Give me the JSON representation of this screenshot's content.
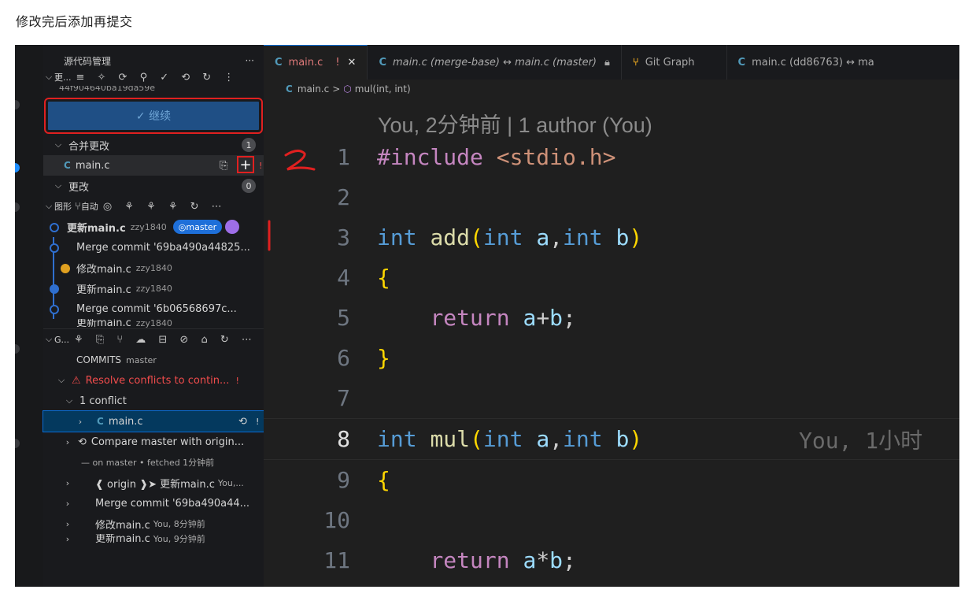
{
  "caption": "修改完后添加再提交",
  "colors": {
    "accent": "#1e6fd9",
    "annotation": "#e02020",
    "conflict": "#f14c4c"
  },
  "sidebar": {
    "title": "源代码管理",
    "more": "···",
    "section_label": "更...",
    "hash_partial": "44f904640ba19da59e",
    "continue_button": "✓ 继续",
    "merge_changes": {
      "label": "合并更改",
      "count": "1"
    },
    "merge_file": {
      "name": "main.c",
      "status": "!"
    },
    "changes": {
      "label": "更改",
      "count": "0"
    },
    "graph_header": {
      "label": "图形",
      "auto": "自动"
    },
    "graph": [
      {
        "message": "更新main.c",
        "author": "zzy1840",
        "branch": "master"
      },
      {
        "message": "Merge commit '69ba490a44825...",
        "author": ""
      },
      {
        "message": "修改main.c",
        "author": "zzy1840"
      },
      {
        "message": "更新main.c",
        "author": "zzy1840"
      },
      {
        "message": "Merge commit '6b06568697c...",
        "author": ""
      },
      {
        "message": "更新main.c",
        "author": "zzy1840"
      }
    ],
    "gitlens": {
      "label": "G...",
      "commits": "COMMITS",
      "branch": "master",
      "resolve": "Resolve conflicts to contin...",
      "resolve_status": "!",
      "conflict_count": "1 conflict",
      "conflict_file": "main.c",
      "conflict_status": "!",
      "compare": "Compare master with origin...",
      "fetched": "— on master • fetched 1分钟前",
      "items": [
        {
          "label": "❰ origin ❱➤  更新main.c",
          "meta": "You,..."
        },
        {
          "label": "Merge commit '69ba490a44...",
          "meta": ""
        },
        {
          "label": "修改main.c",
          "meta": "You, 8分钟前"
        },
        {
          "label": "更新main.c",
          "meta": "You, 9分钟前"
        }
      ]
    }
  },
  "editor": {
    "tabs": [
      {
        "icon": "C",
        "label": "main.c",
        "extra": "!",
        "close": "✕"
      },
      {
        "icon": "C",
        "label": "main.c (merge-base) ↔ main.c (master)",
        "extra": "🔒"
      },
      {
        "icon": "⑂",
        "label": "Git Graph"
      },
      {
        "icon": "C",
        "label": "main.c (dd86763) ↔ ma"
      }
    ],
    "breadcrumb": {
      "file": "main.c",
      "sep": ">",
      "symbol": "mul(int, int)"
    },
    "codelens": "You, 2分钟前 | 1 author (You)",
    "blame_line8": "You, 1小时",
    "lines": [
      "1",
      "2",
      "3",
      "4",
      "5",
      "6",
      "7",
      "8",
      "9",
      "10",
      "11"
    ]
  },
  "annotations": {
    "mark2": "2",
    "mark1": "1"
  }
}
